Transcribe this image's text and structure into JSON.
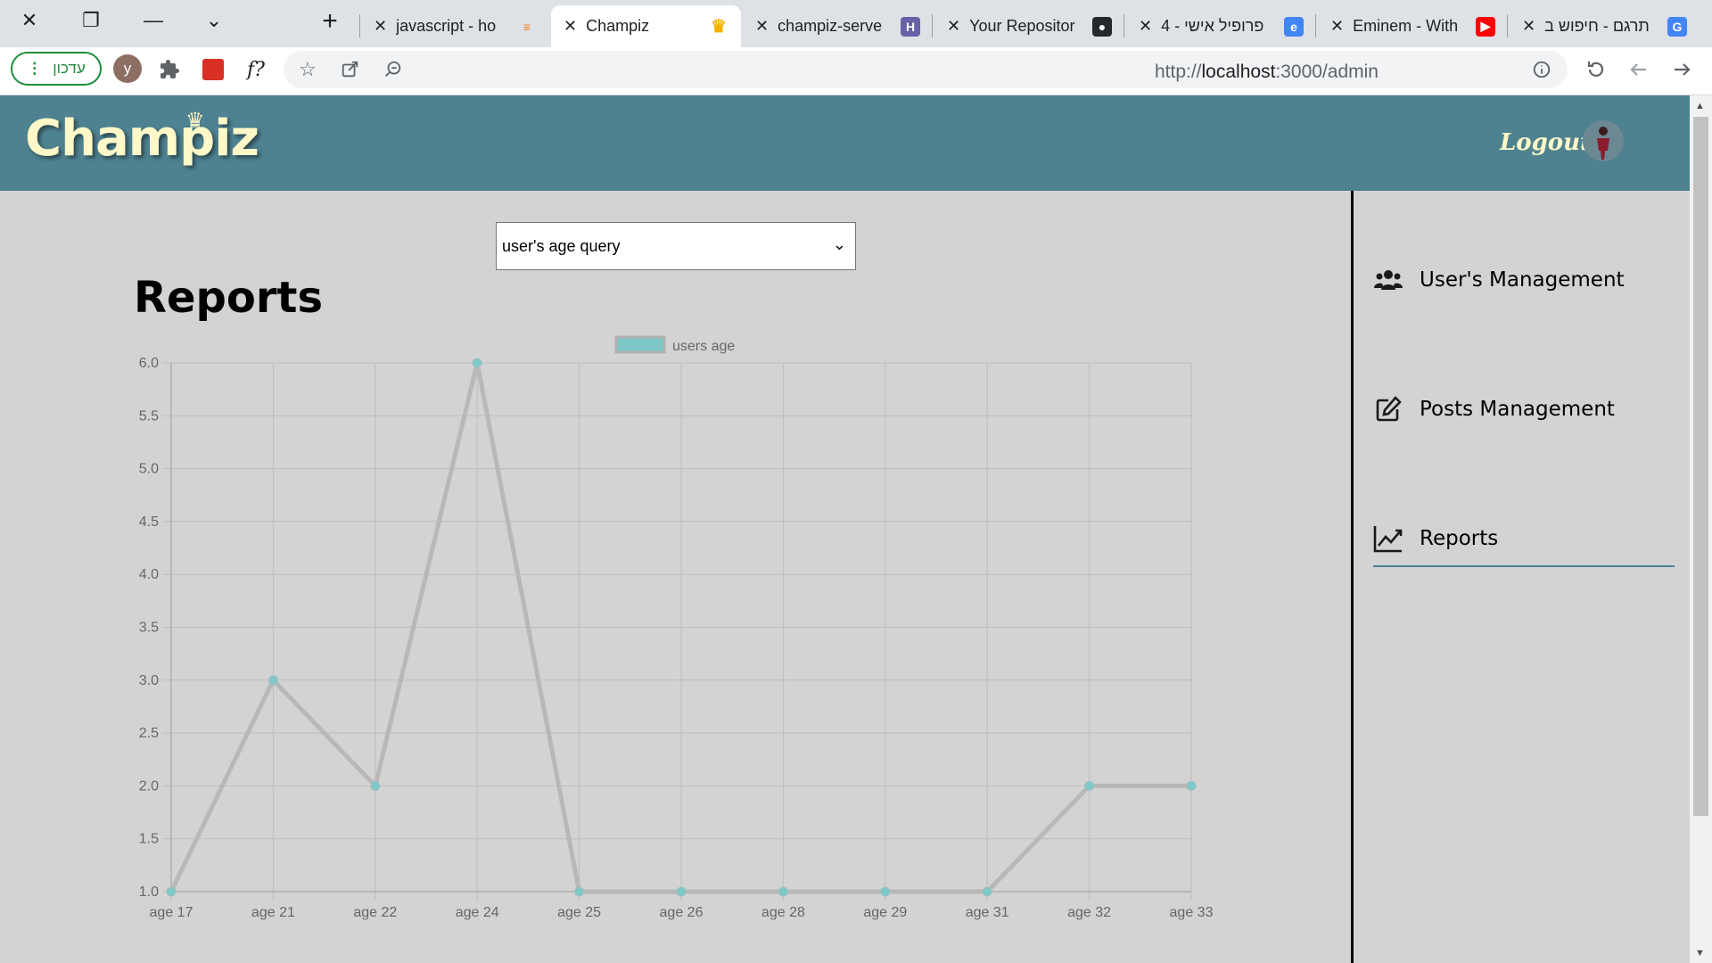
{
  "browser": {
    "tabs": [
      {
        "title": "javascript - ho",
        "favicon": "stackoverflow-icon",
        "favicon_color": "#f48024",
        "active": false
      },
      {
        "title": "Champiz",
        "favicon": "crown-icon",
        "favicon_color": "#f4b400",
        "active": true
      },
      {
        "title": "champiz-serve",
        "favicon": "heroku-icon",
        "favicon_color": "#6762a6",
        "active": false
      },
      {
        "title": "Your Repositor",
        "favicon": "github-icon",
        "favicon_color": "#24292e",
        "active": false
      },
      {
        "title": "פרופיל אישי - 4",
        "favicon": "e-icon",
        "favicon_color": "#4285f4",
        "active": false
      },
      {
        "title": "Eminem - With",
        "favicon": "youtube-icon",
        "favicon_color": "#ff0000",
        "active": false
      },
      {
        "title": "תרגם - חיפוש ב",
        "favicon": "google-icon",
        "favicon_color": "#4285f4",
        "active": false
      }
    ],
    "update_label": "עדכון",
    "profile_initial": "y",
    "extension_label": "f?",
    "url_scheme": "http://",
    "url_host": "localhost",
    "url_rest": ":3000/admin"
  },
  "header": {
    "logo": "Champiz",
    "logout": "Logout"
  },
  "main": {
    "query_select_value": "user's age query",
    "title": "Reports"
  },
  "sidebar": {
    "items": [
      {
        "label": "User's Management",
        "icon": "users-icon"
      },
      {
        "label": "Posts Management",
        "icon": "edit-icon"
      },
      {
        "label": "Reports",
        "icon": "chart-line-icon",
        "active": true
      }
    ]
  },
  "chart_data": {
    "type": "line",
    "categories": [
      "age 17",
      "age 21",
      "age 22",
      "age 24",
      "age 25",
      "age 26",
      "age 28",
      "age 29",
      "age 31",
      "age 32",
      "age 33"
    ],
    "series": [
      {
        "name": "users age",
        "values": [
          1,
          3,
          2,
          6,
          1,
          1,
          1,
          1,
          1,
          2,
          2
        ]
      }
    ],
    "ylim": [
      1.0,
      6.0
    ],
    "yticks": [
      "1.0",
      "1.5",
      "2.0",
      "2.5",
      "3.0",
      "3.5",
      "4.0",
      "4.5",
      "5.0",
      "5.5",
      "6.0"
    ],
    "grid": true,
    "legend": "top-center",
    "colors": {
      "line": "#b8b8b8",
      "point": "#7ec8c8",
      "legend_box": "#7ec8c8"
    }
  }
}
